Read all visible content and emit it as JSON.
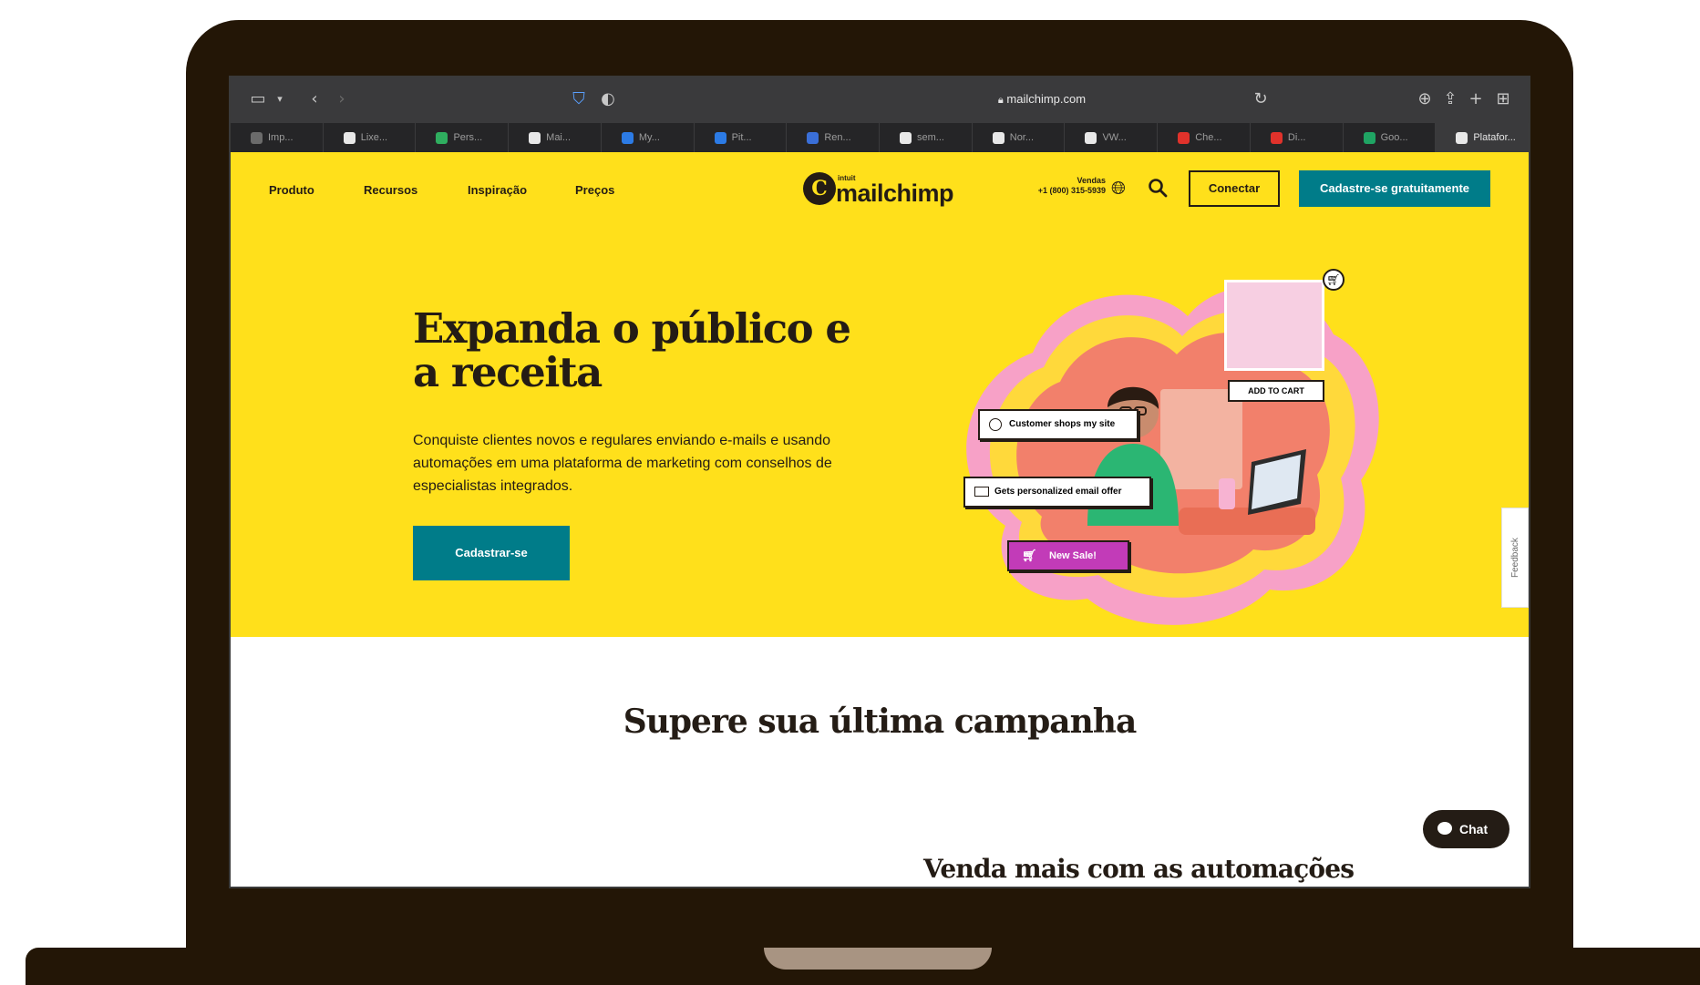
{
  "browser": {
    "url": "mailchimp.com",
    "tabs": [
      {
        "label": "Imp...",
        "color": "#6b6b6b"
      },
      {
        "label": "Lixe...",
        "color": "#e8e8e8"
      },
      {
        "label": "Pers...",
        "color": "#2fae5f"
      },
      {
        "label": "Mai...",
        "color": "#e8e8e8"
      },
      {
        "label": "My...",
        "color": "#2c7be5"
      },
      {
        "label": "Pit...",
        "color": "#2c7be5"
      },
      {
        "label": "Ren...",
        "color": "#3a6fd8"
      },
      {
        "label": "sem...",
        "color": "#e8e8e8"
      },
      {
        "label": "Nor...",
        "color": "#e8e8e8"
      },
      {
        "label": "VW...",
        "color": "#e8e8e8"
      },
      {
        "label": "Che...",
        "color": "#e0322b"
      },
      {
        "label": "Di...",
        "color": "#e0322b"
      },
      {
        "label": "Goo...",
        "color": "#1fa463"
      },
      {
        "label": "Platafor...",
        "color": "#e8e8e8"
      }
    ]
  },
  "nav": {
    "items": [
      "Produto",
      "Recursos",
      "Inspiração",
      "Preços"
    ],
    "logo_small": "intuit",
    "logo_text": "mailchimp",
    "sales_label": "Vendas",
    "sales_phone": "+1 (800) 315-5939",
    "connect_label": "Conectar",
    "signup_label": "Cadastre-se gratuitamente"
  },
  "hero": {
    "headline": "Expanda o público e a receita",
    "subtext": "Conquiste clientes novos e regulares enviando e-mails e usando automações em uma plataforma de marketing com conselhos de especialistas integrados.",
    "cta_label": "Cadastrar-se",
    "illustration": {
      "step1": "Customer shops my site",
      "step2": "Gets personalized email offer",
      "step3": "New Sale!",
      "add_to_cart": "ADD TO CART"
    }
  },
  "feedback_label": "Feedback",
  "section": {
    "title": "Supere sua última campanha",
    "subtitle": "Venda mais com as automações"
  },
  "chat_label": "Chat",
  "colors": {
    "brand_yellow": "#ffe01b",
    "brand_teal": "#007c89",
    "ink": "#241c15",
    "laptop_frame": "#231606",
    "new_sale_magenta": "#c23bb8"
  }
}
